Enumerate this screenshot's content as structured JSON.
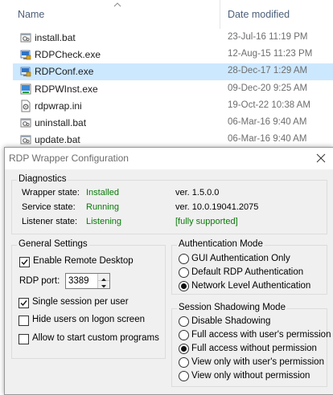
{
  "explorer": {
    "columns": {
      "name": "Name",
      "date_modified": "Date modified"
    },
    "files": [
      {
        "name": "install.bat",
        "date": "23-Jul-16 11:19 PM",
        "icon": "batch-file-icon",
        "selected": false
      },
      {
        "name": "RDPCheck.exe",
        "date": "12-Aug-15 11:23 PM",
        "icon": "exe-icon",
        "selected": false
      },
      {
        "name": "RDPConf.exe",
        "date": "28-Dec-17 1:29 AM",
        "icon": "exe-icon",
        "selected": true
      },
      {
        "name": "RDPWInst.exe",
        "date": "09-Dec-20 9:25 AM",
        "icon": "installer-icon",
        "selected": false
      },
      {
        "name": "rdpwrap.ini",
        "date": "19-Oct-22 10:38 AM",
        "icon": "ini-file-icon",
        "selected": false
      },
      {
        "name": "uninstall.bat",
        "date": "06-Mar-16 9:40 AM",
        "icon": "batch-file-icon",
        "selected": false
      },
      {
        "name": "update.bat",
        "date": "06-Mar-16 9:40 AM",
        "icon": "batch-file-icon",
        "selected": false
      }
    ]
  },
  "dialog": {
    "title": "RDP Wrapper Configuration",
    "diagnostics": {
      "title": "Diagnostics",
      "wrapper_label": "Wrapper state:",
      "wrapper_value": "Installed",
      "wrapper_version": "ver.  1.5.0.0",
      "service_label": "Service state:",
      "service_value": "Running",
      "service_version": "ver.  10.0.19041.2075",
      "listener_label": "Listener state:",
      "listener_value": "Listening",
      "listener_support": "[fully supported]"
    },
    "general": {
      "title": "General Settings",
      "enable_remote_desktop": "Enable Remote Desktop",
      "rdp_port_label": "RDP port:",
      "rdp_port_value": "3389",
      "single_session": "Single session per user",
      "hide_users": "Hide users on logon screen",
      "custom_programs": "Allow to start custom programs"
    },
    "auth": {
      "title": "Authentication Mode",
      "options": [
        "GUI Authentication Only",
        "Default RDP Authentication",
        "Network Level Authentication"
      ],
      "selected_index": 2
    },
    "shadow": {
      "title": "Session Shadowing Mode",
      "options": [
        "Disable Shadowing",
        "Full access with user's permission",
        "Full access without permission",
        "View only with user's permission",
        "View only without permission"
      ],
      "selected_index": 2
    }
  },
  "colors": {
    "selection": "#cce8ff",
    "status_green": "#0b7a0b",
    "dialog_bg": "#f0f0f0"
  }
}
